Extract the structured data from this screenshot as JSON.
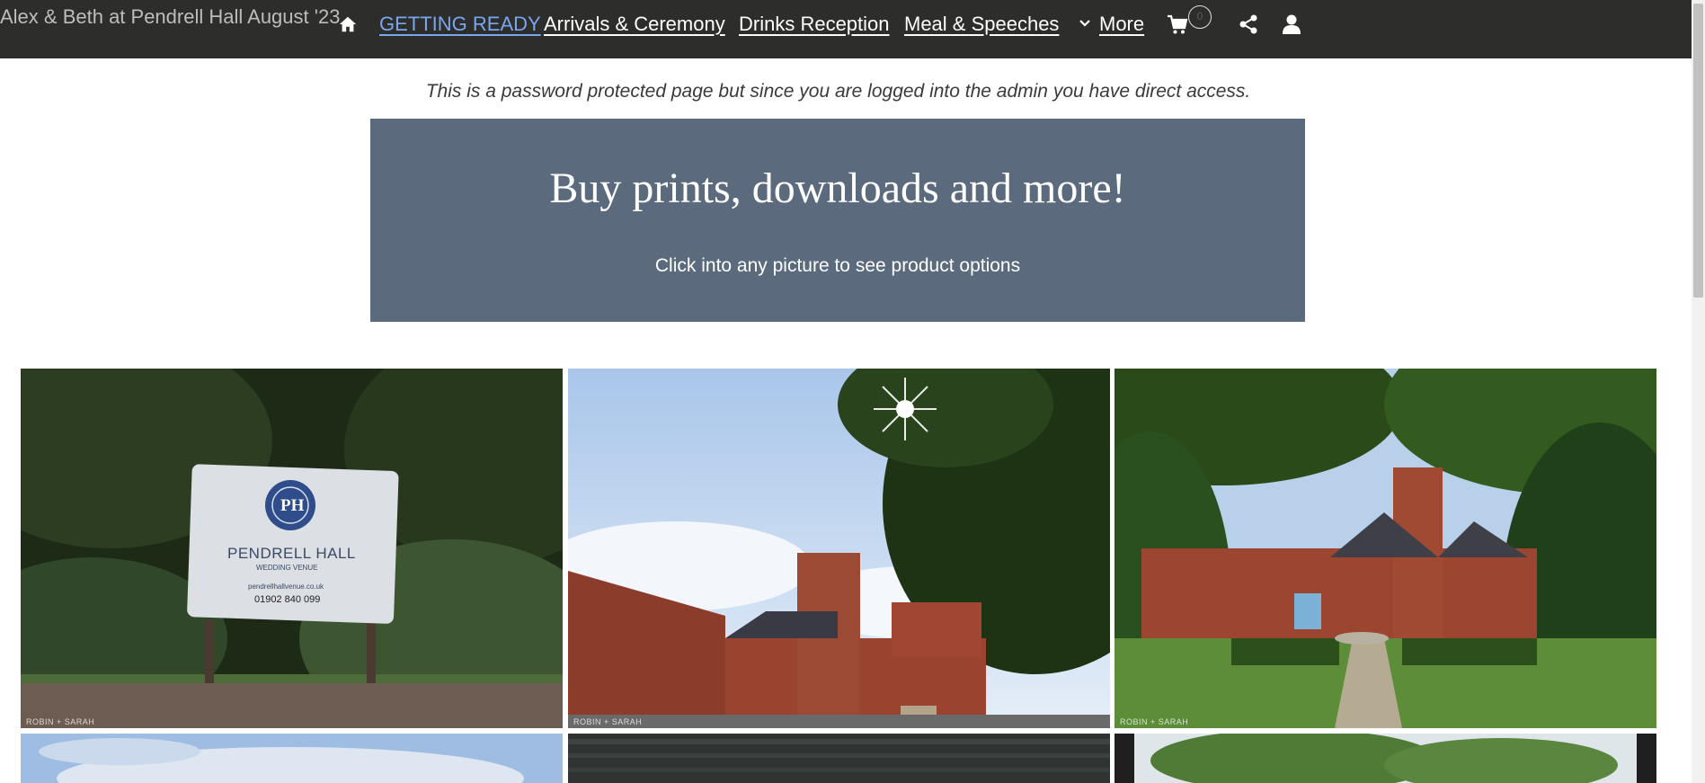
{
  "header": {
    "site_title": "Alex & Beth at Pendrell Hall August '23",
    "nav": [
      {
        "label": "GETTING READY",
        "active": true
      },
      {
        "label": "Arrivals & Ceremony",
        "active": false
      },
      {
        "label": "Drinks Reception",
        "active": false
      },
      {
        "label": "Meal & Speeches",
        "active": false
      },
      {
        "label": "More",
        "active": false
      }
    ],
    "cart_count": "0",
    "icons": {
      "home": "home-icon",
      "more": "chevron-down-icon",
      "cart": "cart-icon",
      "share": "share-icon",
      "user": "user-icon"
    },
    "accent_color": "#79a6ec"
  },
  "notice": "This is a password protected page but since you are logged into the admin you have direct access.",
  "promo": {
    "title": "Buy prints, downloads and more!",
    "subtitle": "Click into any picture to see product options",
    "background": "#5b6b7d"
  },
  "gallery": {
    "photos": [
      {
        "watermark": "ROBIN + SARAH",
        "sign": {
          "monogram": "PH",
          "name": "PENDRELL HALL",
          "tagline": "WEDDING VENUE",
          "website": "pendrellhallvenue.co.uk",
          "phone": "01902 840 099"
        }
      },
      {
        "watermark": "ROBIN + SARAH"
      },
      {
        "watermark": "ROBIN + SARAH"
      }
    ]
  }
}
